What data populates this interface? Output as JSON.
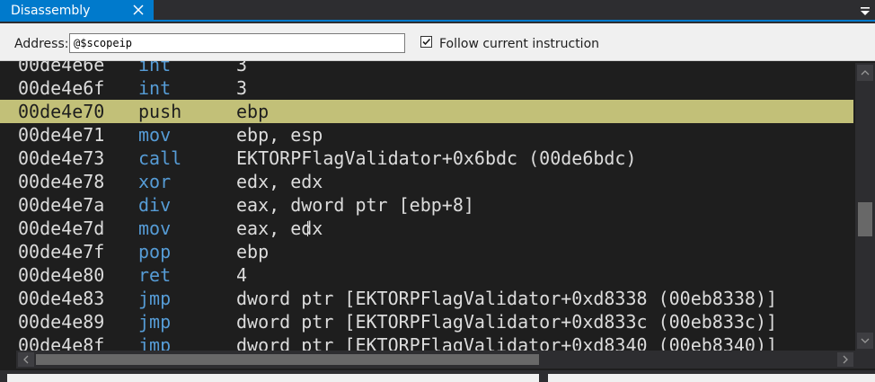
{
  "window": {
    "tab_title": "Disassembly"
  },
  "toolbar": {
    "address_label": "Address:",
    "address_value": "@$scopeip",
    "follow_label": "Follow current instruction",
    "follow_checked": true
  },
  "disassembly": {
    "lines": [
      {
        "address": "00de4e6e",
        "op": "int",
        "args": "3"
      },
      {
        "address": "00de4e6f",
        "op": "int",
        "args": "3"
      },
      {
        "address": "00de4e70",
        "op": "push",
        "args": "ebp",
        "current": true
      },
      {
        "address": "00de4e71",
        "op": "mov",
        "args": "ebp, esp"
      },
      {
        "address": "00de4e73",
        "op": "call",
        "args": "EKTORPFlagValidator+0x6bdc (00de6bdc)"
      },
      {
        "address": "00de4e78",
        "op": "xor",
        "args": "edx, edx"
      },
      {
        "address": "00de4e7a",
        "op": "div",
        "args": "eax, dword ptr [ebp+8]"
      },
      {
        "address": "00de4e7d",
        "op": "mov",
        "args": "eax, edx"
      },
      {
        "address": "00de4e7f",
        "op": "pop",
        "args": "ebp"
      },
      {
        "address": "00de4e80",
        "op": "ret",
        "args": "4"
      },
      {
        "address": "00de4e83",
        "op": "jmp",
        "args": "dword ptr [EKTORPFlagValidator+0xd8338 (00eb8338)]"
      },
      {
        "address": "00de4e89",
        "op": "jmp",
        "args": "dword ptr [EKTORPFlagValidator+0xd833c (00eb833c)]"
      },
      {
        "address": "00de4e8f",
        "op": "jmp",
        "args": "dword ptr [EKTORPFlagValidator+0xd8340 (00eb8340)]"
      }
    ]
  },
  "colors": {
    "accent": "#007acc",
    "current_line_bg": "#c2c078",
    "opcode": "#569cd6",
    "text": "#dcdcdc",
    "background": "#1e1e1e"
  },
  "icons": {
    "close": "close-icon",
    "menu": "chevron-down-icon",
    "check": "check-icon"
  }
}
